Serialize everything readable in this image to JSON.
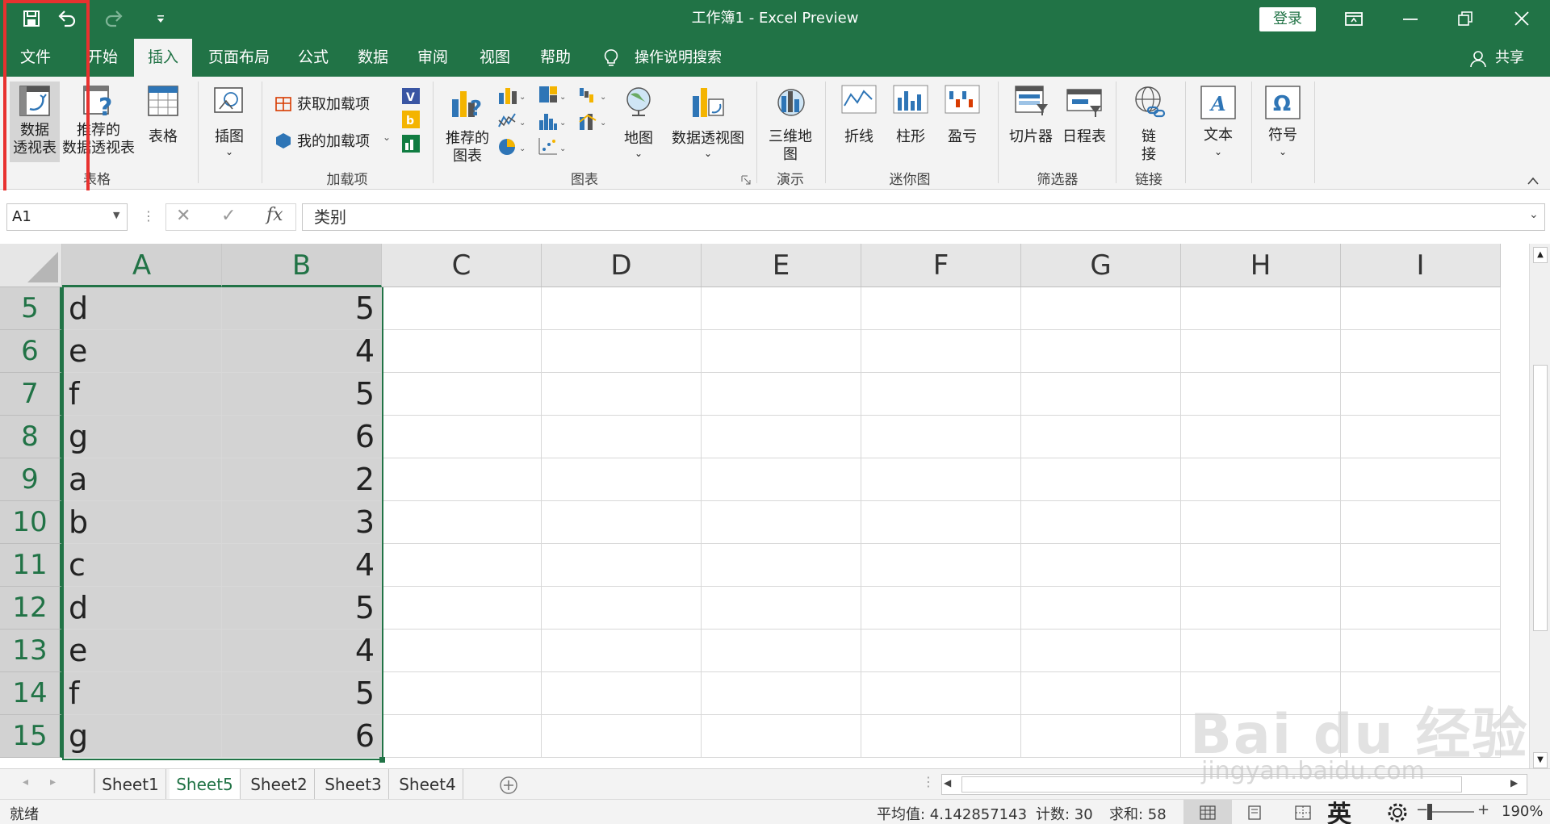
{
  "title_bar": {
    "title": "工作簿1 - Excel Preview",
    "login_label": "登录"
  },
  "tabs": [
    {
      "label": "文件",
      "active": false
    },
    {
      "label": "开始",
      "active": false
    },
    {
      "label": "插入",
      "active": true
    },
    {
      "label": "页面布局",
      "active": false
    },
    {
      "label": "公式",
      "active": false
    },
    {
      "label": "数据",
      "active": false
    },
    {
      "label": "审阅",
      "active": false
    },
    {
      "label": "视图",
      "active": false
    },
    {
      "label": "帮助",
      "active": false
    }
  ],
  "tell_me": "操作说明搜索",
  "share": "共享",
  "ribbon": {
    "pivot_table": [
      "数据",
      "透视表"
    ],
    "recommended_pivot": [
      "推荐的",
      "数据透视表"
    ],
    "table": "表格",
    "group_tables": "表格",
    "illustrations": "插图",
    "get_addins": "获取加载项",
    "my_addins": "我的加载项",
    "group_addins": "加载项",
    "recommended_charts": [
      "推荐的",
      "图表"
    ],
    "maps": "地图",
    "pivot_chart": "数据透视图",
    "group_charts": "图表",
    "map_3d": [
      "三维地",
      "图"
    ],
    "group_tours": "演示",
    "sparkline_line": "折线",
    "sparkline_column": "柱形",
    "sparkline_winloss": "盈亏",
    "group_sparklines": "迷你图",
    "slicer": "切片器",
    "timeline": "日程表",
    "group_filters": "筛选器",
    "link": [
      "链",
      "接"
    ],
    "group_links": "链接",
    "text": "文本",
    "symbols": "符号"
  },
  "formula_bar": {
    "name_box": "A1",
    "fx": "fx",
    "content": "类别"
  },
  "columns": [
    "A",
    "B",
    "C",
    "D",
    "E",
    "F",
    "G",
    "H",
    "I"
  ],
  "rows": [
    {
      "n": "5",
      "a": "d",
      "b": "5"
    },
    {
      "n": "6",
      "a": "e",
      "b": "4"
    },
    {
      "n": "7",
      "a": "f",
      "b": "5"
    },
    {
      "n": "8",
      "a": "g",
      "b": "6"
    },
    {
      "n": "9",
      "a": "a",
      "b": "2"
    },
    {
      "n": "10",
      "a": "b",
      "b": "3"
    },
    {
      "n": "11",
      "a": "c",
      "b": "4"
    },
    {
      "n": "12",
      "a": "d",
      "b": "5"
    },
    {
      "n": "13",
      "a": "e",
      "b": "4"
    },
    {
      "n": "14",
      "a": "f",
      "b": "5"
    },
    {
      "n": "15",
      "a": "g",
      "b": "6"
    }
  ],
  "sheets": [
    {
      "label": "Sheet1",
      "active": false
    },
    {
      "label": "Sheet5",
      "active": true
    },
    {
      "label": "Sheet2",
      "active": false
    },
    {
      "label": "Sheet3",
      "active": false
    },
    {
      "label": "Sheet4",
      "active": false
    }
  ],
  "status": {
    "ready": "就绪",
    "average": "平均值: 4.142857143",
    "count": "计数: 30",
    "sum": "求和: 58",
    "zoom": "190%",
    "ime": "英"
  },
  "watermark": {
    "brand": "Bai du 经验",
    "url": "jingyan.baidu.com"
  },
  "colors": {
    "excel_green": "#217346",
    "highlight_red": "#e8312f",
    "selection_gray": "#d3d3d3"
  }
}
